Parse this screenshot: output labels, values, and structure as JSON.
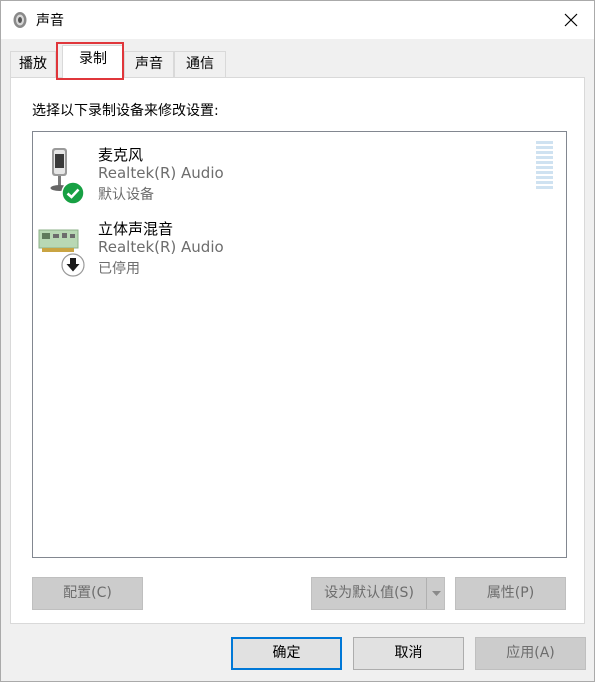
{
  "window": {
    "title": "声音",
    "title_icon": "speaker-icon",
    "close_icon": "close-icon"
  },
  "tabs": [
    {
      "label": "播放",
      "active": false
    },
    {
      "label": "录制",
      "active": true
    },
    {
      "label": "声音",
      "active": false
    },
    {
      "label": "通信",
      "active": false
    }
  ],
  "panel": {
    "instruction": "选择以下录制设备来修改设置:",
    "devices": [
      {
        "name": "麦克风",
        "driver": "Realtek(R) Audio",
        "status": "默认设备",
        "icon": "microphone-icon",
        "badge": "check-badge-icon",
        "selected": false
      },
      {
        "name": "立体声混音",
        "driver": "Realtek(R) Audio",
        "status": "已停用",
        "icon": "sound-card-icon",
        "badge": "down-arrow-badge-icon",
        "selected": false
      }
    ],
    "level_meter_icon": "level-meter-icon",
    "buttons": {
      "configure": "配置(C)",
      "set_default": "设为默认值(S)",
      "properties": "属性(P)"
    }
  },
  "footer": {
    "ok": "确定",
    "cancel": "取消",
    "apply": "应用(A)"
  },
  "colors": {
    "accent": "#0078d7",
    "highlight_box": "#e0363b",
    "badge_green": "#17a043"
  }
}
